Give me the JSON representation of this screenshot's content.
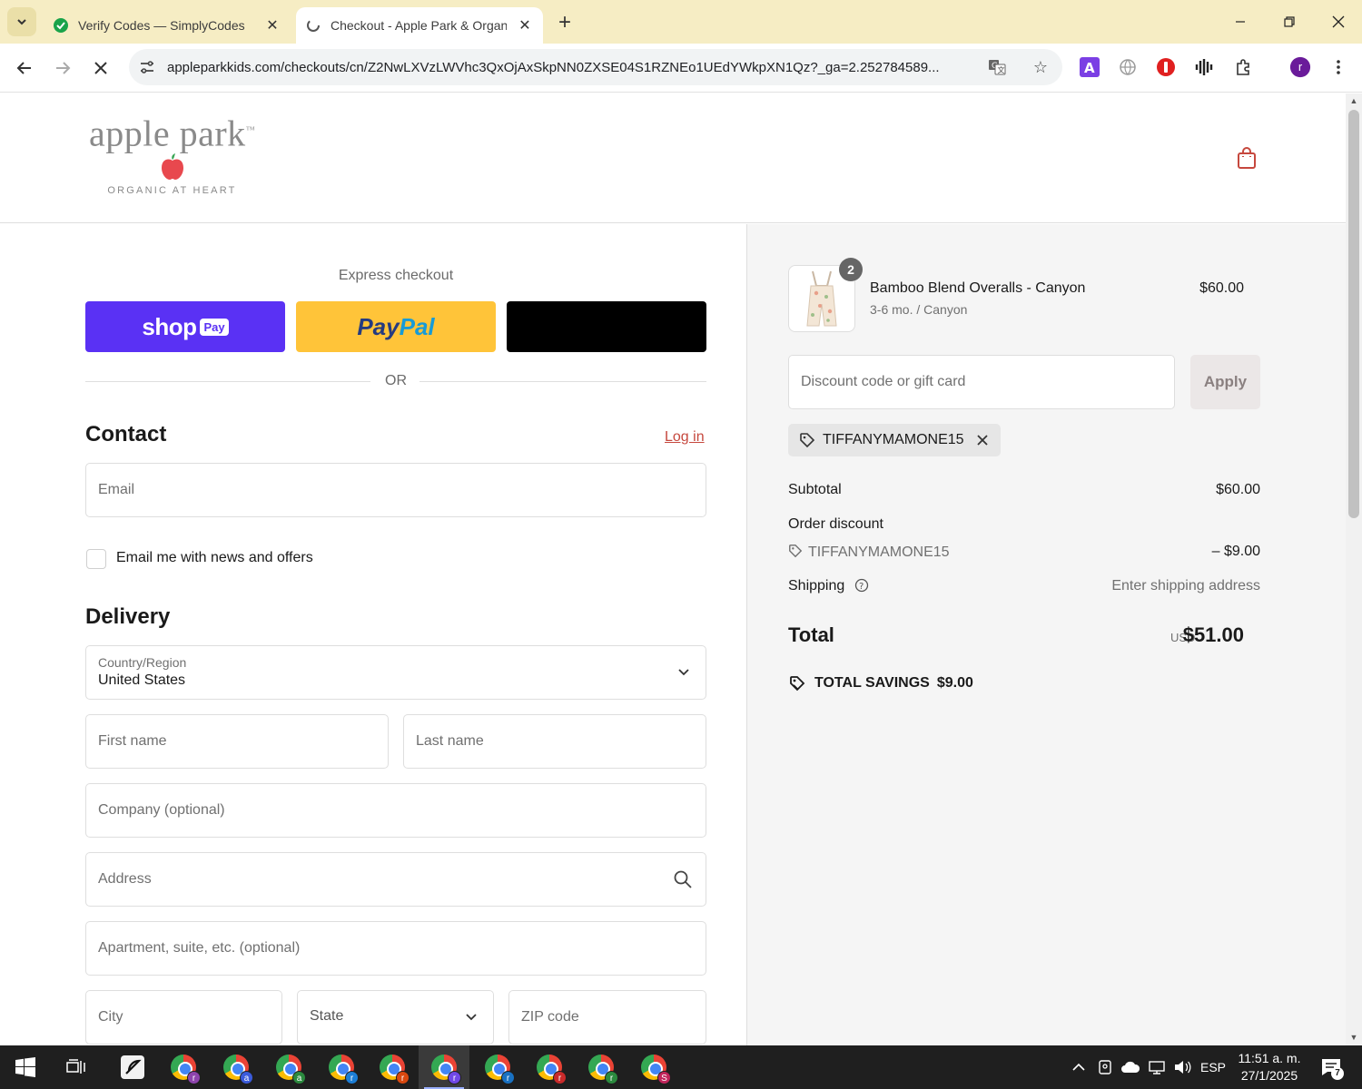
{
  "browser": {
    "tabs": [
      {
        "title": "Verify Codes — SimplyCodes",
        "active": false
      },
      {
        "title": "Checkout - Apple Park & Organic",
        "active": true
      }
    ],
    "url": "appleparkkids.com/checkouts/cn/Z2NwLXVzLWVhc3QxOjAxSkpNN0ZXSE04S1RZNEo1UEdYWkpXN1Qz?_ga=2.252784589...",
    "profile_initial": "r"
  },
  "header": {
    "logo_word": "apple park",
    "logo_tm": "™",
    "logo_tagline": "ORGANIC AT HEART"
  },
  "express": {
    "label": "Express checkout",
    "shop_word": "shop",
    "shop_pay": "Pay",
    "paypal_a": "Pay",
    "paypal_b": "Pal",
    "or": "OR"
  },
  "contact": {
    "heading": "Contact",
    "login": "Log in",
    "email_placeholder": "Email",
    "newsletter_label": "Email me with news and offers"
  },
  "delivery": {
    "heading": "Delivery",
    "country_label": "Country/Region",
    "country_value": "United States",
    "first_name": "First name",
    "last_name": "Last name",
    "company": "Company (optional)",
    "address": "Address",
    "apartment": "Apartment, suite, etc. (optional)",
    "city": "City",
    "state": "State",
    "zip": "ZIP code"
  },
  "summary": {
    "item": {
      "quantity": "2",
      "name": "Bamboo Blend Overalls - Canyon",
      "variant": "3-6 mo. / Canyon",
      "price": "$60.00"
    },
    "discount_placeholder": "Discount code or gift card",
    "apply": "Apply",
    "applied_code": "TIFFANYMAMONE15",
    "subtotal_label": "Subtotal",
    "subtotal_value": "$60.00",
    "order_discount_label": "Order discount",
    "discount_code": "TIFFANYMAMONE15",
    "discount_value": "– $9.00",
    "shipping_label": "Shipping",
    "shipping_value": "Enter shipping address",
    "total_label": "Total",
    "total_currency": "USD",
    "total_value": "$51.00",
    "savings_label": "TOTAL SAVINGS",
    "savings_value": "$9.00"
  },
  "taskbar": {
    "time": "11:51 a. m.",
    "date": "27/1/2025",
    "language": "ESP",
    "notifications": "7",
    "apps": [
      {
        "badge": "r",
        "color": "#8e44ad"
      },
      {
        "badge": "a",
        "color": "#3b5bdb"
      },
      {
        "badge": "a",
        "color": "#2b8a3e"
      },
      {
        "badge": "r",
        "color": "#1c7ed6"
      },
      {
        "badge": "r",
        "color": "#d9480f"
      },
      {
        "badge": "r",
        "color": "#7048e8"
      },
      {
        "badge": "r",
        "color": "#1971c2"
      },
      {
        "badge": "r",
        "color": "#c92a2a"
      },
      {
        "badge": "r",
        "color": "#2b8a3e"
      },
      {
        "badge": "S",
        "color": "#c2255c"
      }
    ]
  },
  "colors": {
    "tabstrip": "#f6edc4",
    "shop_pay": "#5a31f4",
    "paypal": "#ffc439",
    "link": "#c6483e",
    "summary_bg": "#f5f5f5"
  }
}
